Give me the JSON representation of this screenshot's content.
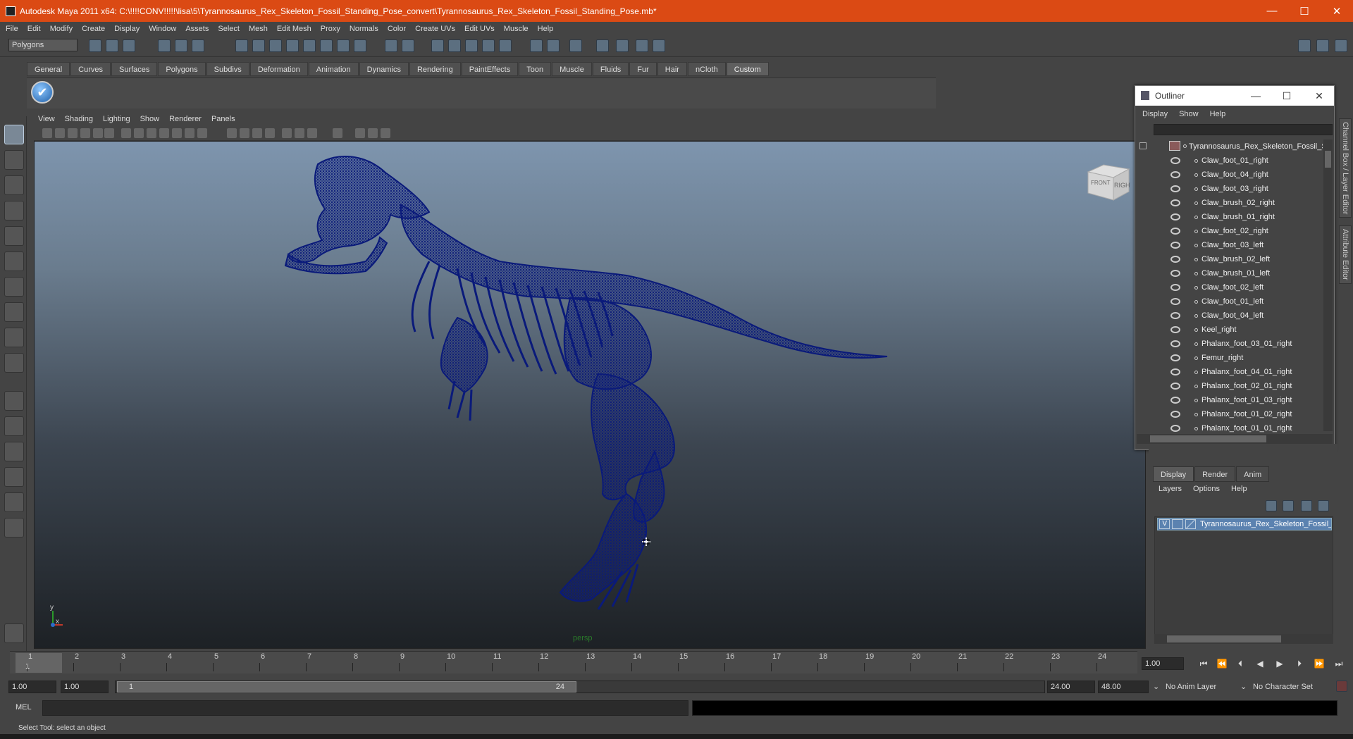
{
  "window": {
    "title": "Autodesk Maya 2011 x64: C:\\!!!!CONV!!!!!\\lisa\\5\\Tyrannosaurus_Rex_Skeleton_Fossil_Standing_Pose_convert\\Tyrannosaurus_Rex_Skeleton_Fossil_Standing_Pose.mb*",
    "minimize": "—",
    "maximize": "☐",
    "close": "✕"
  },
  "menubar": [
    "File",
    "Edit",
    "Modify",
    "Create",
    "Display",
    "Window",
    "Assets",
    "Select",
    "Mesh",
    "Edit Mesh",
    "Proxy",
    "Normals",
    "Color",
    "Create UVs",
    "Edit UVs",
    "Muscle",
    "Help"
  ],
  "statusline": {
    "mode": "Polygons"
  },
  "shelf": {
    "tabs": [
      "General",
      "Curves",
      "Surfaces",
      "Polygons",
      "Subdivs",
      "Deformation",
      "Animation",
      "Dynamics",
      "Rendering",
      "PaintEffects",
      "Toon",
      "Muscle",
      "Fluids",
      "Fur",
      "Hair",
      "nCloth",
      "Custom"
    ],
    "active_tab": "Custom",
    "check_icon": "✔"
  },
  "viewport": {
    "menu": [
      "View",
      "Shading",
      "Lighting",
      "Show",
      "Renderer",
      "Panels"
    ],
    "camera_label": "persp",
    "viewcube": {
      "front": "FRONT",
      "right": "RIGHT"
    },
    "axis": {
      "y": "y",
      "x": "x"
    },
    "wire_color": "#0a1a7a"
  },
  "outliner": {
    "title": "Outliner",
    "menu": [
      "Display",
      "Show",
      "Help"
    ],
    "root": "Tyrannosaurus_Rex_Skeleton_Fossil_St",
    "items": [
      "Claw_foot_01_right",
      "Claw_foot_04_right",
      "Claw_foot_03_right",
      "Claw_brush_02_right",
      "Claw_brush_01_right",
      "Claw_foot_02_right",
      "Claw_foot_03_left",
      "Claw_brush_02_left",
      "Claw_brush_01_left",
      "Claw_foot_02_left",
      "Claw_foot_01_left",
      "Claw_foot_04_left",
      "Keel_right",
      "Phalanx_foot_03_01_right",
      "Femur_right",
      "Phalanx_foot_04_01_right",
      "Phalanx_foot_02_01_right",
      "Phalanx_foot_01_03_right",
      "Phalanx_foot_01_02_right",
      "Phalanx_foot_01_01_right"
    ]
  },
  "side_tabs": [
    "Channel Box / Layer Editor",
    "Attribute Editor"
  ],
  "layer_editor": {
    "tabs": [
      "Display",
      "Render",
      "Anim"
    ],
    "active_tab": "Display",
    "menu": [
      "Layers",
      "Options",
      "Help"
    ],
    "layer": {
      "visible": "V",
      "name": "Tyrannosaurus_Rex_Skeleton_Fossil_S"
    }
  },
  "timeline": {
    "ticks": [
      "1",
      "2",
      "3",
      "4",
      "5",
      "6",
      "7",
      "8",
      "9",
      "10",
      "11",
      "12",
      "13",
      "14",
      "15",
      "16",
      "17",
      "18",
      "19",
      "20",
      "21",
      "22",
      "23",
      "24"
    ],
    "current_frame": "1",
    "current_field": "1.00"
  },
  "range": {
    "start": "1.00",
    "playback_start": "1.00",
    "slider_start": "1",
    "slider_end": "24",
    "playback_end": "24.00",
    "end": "48.00",
    "anim_layer": "No Anim Layer",
    "character_set": "No Character Set"
  },
  "command": {
    "label": "MEL"
  },
  "helpline": "Select Tool: select an object"
}
